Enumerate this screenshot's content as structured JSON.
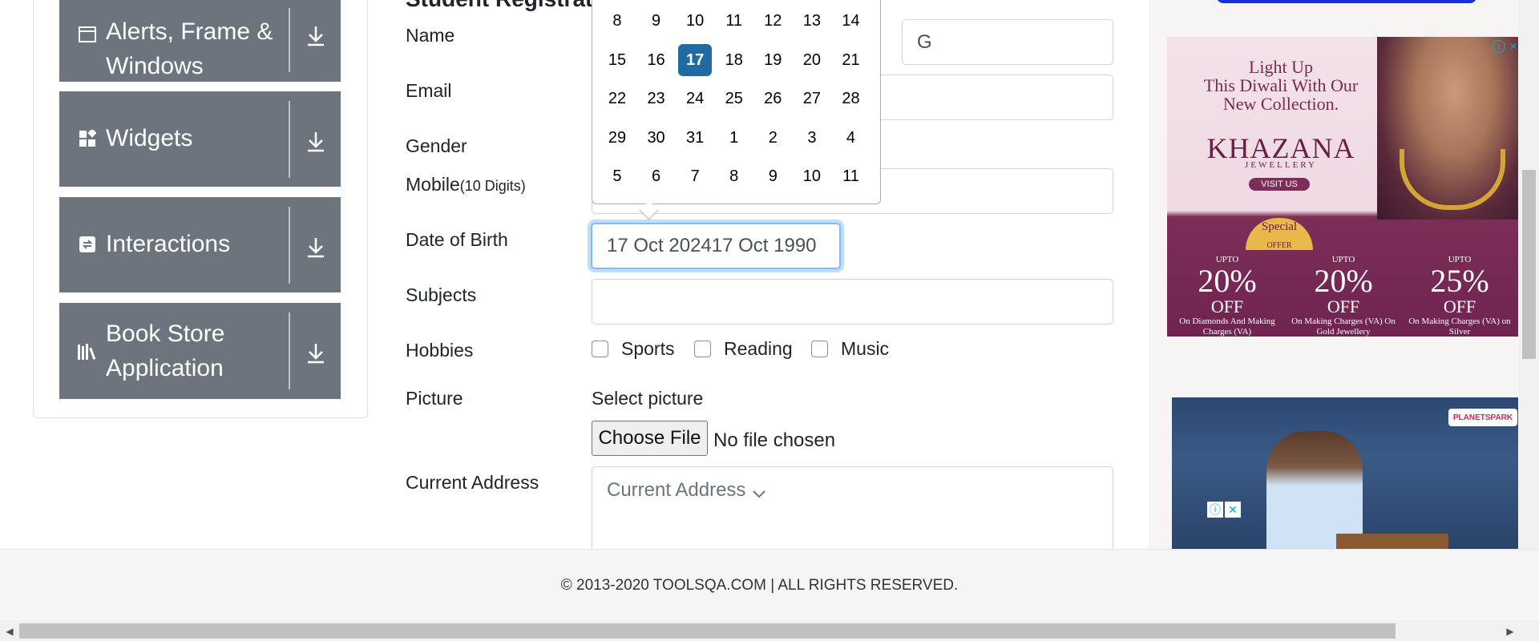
{
  "sidebar": {
    "items": [
      {
        "label": "Alerts, Frame & Windows",
        "icon": "window-icon"
      },
      {
        "label": "Widgets",
        "icon": "widgets-icon"
      },
      {
        "label": "Interactions",
        "icon": "interactions-icon"
      },
      {
        "label": "Book Store Application",
        "icon": "books-icon"
      }
    ],
    "download_icon": "download-arrow-icon"
  },
  "form": {
    "title": "Student Registration Form",
    "name_label": "Name",
    "last_name_value": "G",
    "email_label": "Email",
    "gender_label": "Gender",
    "mobile_label": "Mobile",
    "mobile_hint": "(10 Digits)",
    "dob_label": "Date of Birth",
    "dob_value": "17 Oct 202417 Oct 1990",
    "subjects_label": "Subjects",
    "hobbies_label": "Hobbies",
    "hobbies": [
      "Sports",
      "Reading",
      "Music"
    ],
    "picture_label": "Picture",
    "select_picture": "Select picture",
    "choose_file_button": "Choose File",
    "no_file_text": "No file chosen",
    "address_label": "Current Address",
    "address_placeholder": "Current Address"
  },
  "datepicker": {
    "selected_day": "17",
    "weeks": [
      [
        "8",
        "9",
        "10",
        "11",
        "12",
        "13",
        "14"
      ],
      [
        "15",
        "16",
        "17",
        "18",
        "19",
        "20",
        "21"
      ],
      [
        "22",
        "23",
        "24",
        "25",
        "26",
        "27",
        "28"
      ],
      [
        "29",
        "30",
        "31",
        "1",
        "2",
        "3",
        "4"
      ],
      [
        "5",
        "6",
        "7",
        "8",
        "9",
        "10",
        "11"
      ]
    ]
  },
  "ads": {
    "khazana": {
      "headline": [
        "Light Up",
        "This Diwali With Our",
        "New Collection."
      ],
      "brand": "KHAZANA",
      "brand_sub": "JEWELLERY",
      "cta": "VISIT US",
      "special": "Special",
      "special_sub": "OFFER",
      "offers": [
        {
          "prefix": "UPTO",
          "pct": "20%",
          "off": "OFF",
          "desc": "On Diamonds And Making Charges (VA)"
        },
        {
          "prefix": "UPTO",
          "pct": "20%",
          "off": "OFF",
          "desc": "On Making Charges (VA) On Gold Jewellery"
        },
        {
          "prefix": "UPTO",
          "pct": "25%",
          "off": "OFF",
          "desc": "On Making Charges (VA) on Silver"
        }
      ]
    },
    "planetspark": {
      "logo": "PLANETSPARK"
    }
  },
  "footer": {
    "copyright": "© 2013-2020 TOOLSQA.COM | ALL RIGHTS RESERVED."
  },
  "colors": {
    "menu_tile": "#6c757d",
    "selected_day": "#216ba5",
    "focus_border": "#80bdff"
  }
}
